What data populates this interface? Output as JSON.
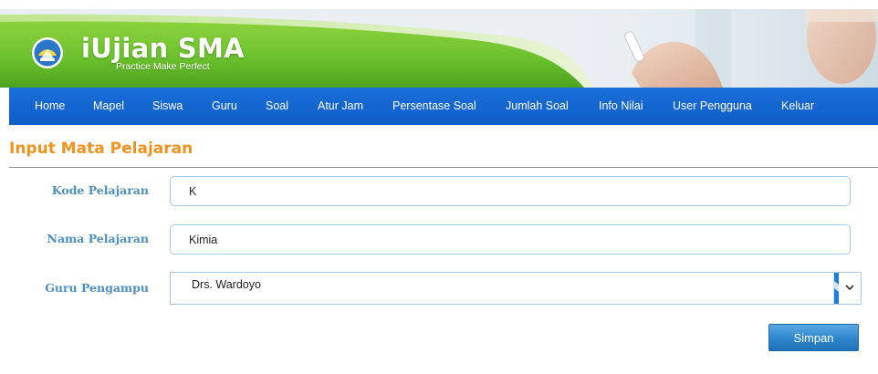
{
  "header": {
    "logo_title": "iUjian SMA",
    "tagline": "Practice Make Perfect",
    "colors": {
      "banner_green": "#6cc12d",
      "nav_blue": "#1466d0"
    }
  },
  "nav": {
    "items": [
      {
        "label": "Home"
      },
      {
        "label": "Mapel"
      },
      {
        "label": "Siswa"
      },
      {
        "label": "Guru"
      },
      {
        "label": "Soal"
      },
      {
        "label": "Atur Jam"
      },
      {
        "label": "Persentase Soal"
      },
      {
        "label": "Jumlah Soal"
      },
      {
        "label": "Info Nilai"
      },
      {
        "label": "User Pengguna"
      },
      {
        "label": "Keluar"
      }
    ]
  },
  "page": {
    "title": "Input Mata Pelajaran",
    "title_color": "#f0921e"
  },
  "form": {
    "kode_label": "Kode Pelajaran",
    "kode_value": "K",
    "nama_label": "Nama Pelajaran",
    "nama_value": "Kimia",
    "guru_label": "Guru Pengampu",
    "guru_selected": "Drs. Wardoyo",
    "save_label": "Simpan"
  }
}
